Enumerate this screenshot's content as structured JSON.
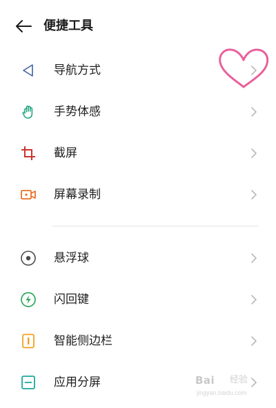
{
  "header": {
    "back_icon": "arrow-left-icon",
    "title": "便捷工具"
  },
  "groups": [
    {
      "items": [
        {
          "label": "导航方式",
          "icon": "navigation-triangle-icon",
          "icon_color": "#3f5fa6"
        },
        {
          "label": "手势体感",
          "icon": "hand-gesture-icon",
          "icon_color": "#17a37a"
        },
        {
          "label": "截屏",
          "icon": "crop-icon",
          "icon_color": "#c9342e"
        },
        {
          "label": "屏幕录制",
          "icon": "video-camera-icon",
          "icon_color": "#e8702a"
        }
      ]
    },
    {
      "items": [
        {
          "label": "悬浮球",
          "icon": "floating-ball-icon",
          "icon_color": "#4a4a4a"
        },
        {
          "label": "闪回键",
          "icon": "lightning-icon",
          "icon_color": "#27a85a"
        },
        {
          "label": "智能侧边栏",
          "icon": "sidebar-icon",
          "icon_color": "#f0a020"
        },
        {
          "label": "应用分屏",
          "icon": "split-screen-icon",
          "icon_color": "#1aa89a"
        }
      ]
    }
  ],
  "chevron_icon": "chevron-right-icon",
  "decoration": {
    "icon": "heart-icon",
    "color": "#e9609b"
  },
  "watermark": {
    "logo": "Bai",
    "sub": "经验",
    "url": "jingyan.baidu.com"
  },
  "colors": {
    "background": "#ffffff",
    "divider": "#e3e3e3",
    "chevron": "#b9b9b9",
    "text": "#1e1e1e"
  }
}
